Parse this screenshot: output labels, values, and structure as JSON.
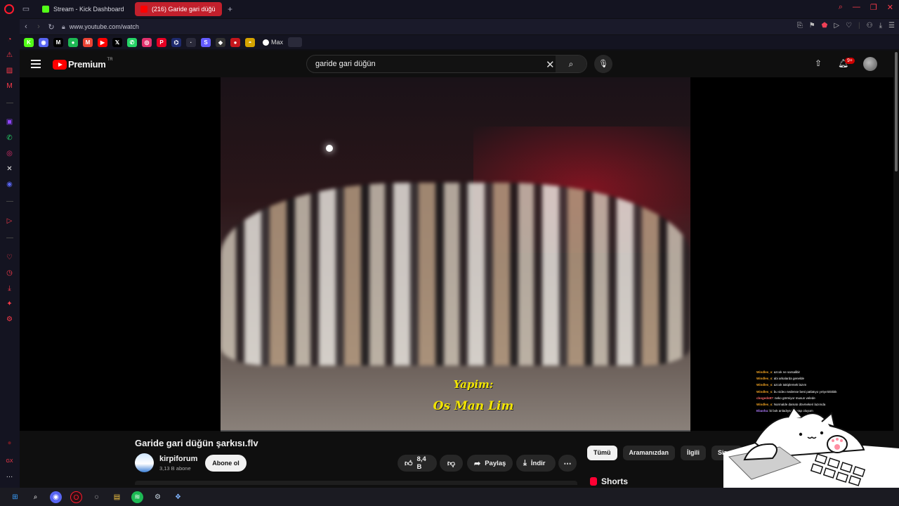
{
  "browser": {
    "tabs": [
      {
        "label": "Stream - Kick Dashboard",
        "favicon_color": "#53fc18"
      },
      {
        "label": "(216) Garide gari düğü",
        "favicon_color": "#ff0000"
      }
    ],
    "new_tab": "+",
    "url": "www.youtube.com/watch",
    "bookmarks": [
      {
        "icon": "kick-icon",
        "glyph": "K",
        "color": "#53fc18"
      },
      {
        "icon": "discord-icon",
        "glyph": "◉",
        "color": "#5865f2"
      },
      {
        "icon": "medium-icon",
        "glyph": "M",
        "color": "#000000"
      },
      {
        "icon": "spotify-icon",
        "glyph": "●",
        "color": "#1db954"
      },
      {
        "icon": "gmail-icon",
        "glyph": "M",
        "color": "#ea4335"
      },
      {
        "icon": "youtube-icon",
        "glyph": "▶",
        "color": "#ff0000"
      },
      {
        "icon": "x-icon",
        "glyph": "𝕏",
        "color": "#000000"
      },
      {
        "icon": "whatsapp-icon",
        "glyph": "✆",
        "color": "#25d366"
      },
      {
        "icon": "instagram-icon",
        "glyph": "◎",
        "color": "#e1306c"
      },
      {
        "icon": "pinterest-icon",
        "glyph": "P",
        "color": "#e60023"
      },
      {
        "icon": "bookmark-icon",
        "glyph": "⌬",
        "color": "#1e2a6e"
      },
      {
        "icon": "bookmark-icon",
        "glyph": "·",
        "color": "#2a2a3a"
      },
      {
        "icon": "stripe-icon",
        "glyph": "S",
        "color": "#635bff"
      },
      {
        "icon": "bookmark-icon",
        "glyph": "◆",
        "color": "#333333"
      },
      {
        "icon": "bookmark-icon",
        "glyph": "●",
        "color": "#c4161c"
      },
      {
        "icon": "bookmark-icon",
        "glyph": "◓",
        "color": "#d4a300"
      }
    ],
    "bookmark_max_label": "Max"
  },
  "youtube": {
    "logo_text": "Premium",
    "logo_region": "TR",
    "search_query": "garide gari düğün",
    "notification_count": "9+",
    "video": {
      "caption_line1": "Yapim:",
      "caption_line2": "Os Man Lim"
    },
    "title": "Garide gari düğün şarkısı.flv",
    "channel": {
      "name": "kirpiforum",
      "subscribers": "3,13 B abone",
      "subscribe_label": "Abone ol"
    },
    "actions": {
      "like_count": "8,4 B",
      "share_label": "Paylaş",
      "download_label": "İndir"
    },
    "chips": [
      "Tümü",
      "Aramanızdan",
      "İlgili",
      "Size ö"
    ],
    "shorts_label": "Shorts"
  },
  "chat": [
    {
      "user": "Windles_s",
      "msg": ": azcok ne sarsalibir"
    },
    {
      "user": "Windles_s",
      "msg": ": abi arkalarda genelde"
    },
    {
      "user": "Windles_s",
      "msg": ": azcok takiplemek lazım"
    },
    {
      "user": "Windles_s",
      "msg": ": bu video nedense beni patlatıyo yırtyırtıkkkkk"
    },
    {
      "user": "cbogeds87",
      "msg": ": neko görmiyor musun velede"
    },
    {
      "user": "Windles_s",
      "msg": ": Normalde damatı dövmekeri lazımda"
    },
    {
      "user": "Ebasha",
      "msg": ": bi bok anladıysam arap oluyum"
    }
  ]
}
